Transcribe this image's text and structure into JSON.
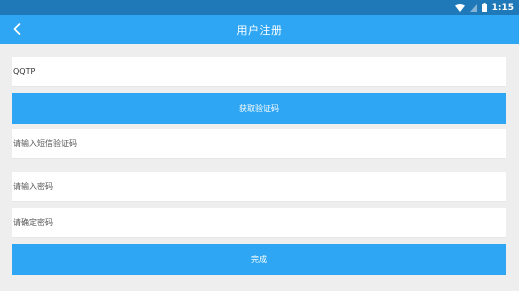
{
  "status_bar": {
    "time": "1:15",
    "icons": [
      "wifi-icon",
      "signal-icon",
      "battery-icon"
    ]
  },
  "header": {
    "title": "用户注册",
    "back_icon": "chevron-left-icon"
  },
  "form": {
    "username": {
      "value": "QQTP",
      "placeholder": ""
    },
    "get_code_label": "获取验证码",
    "sms_code": {
      "value": "",
      "placeholder": "请输入短信验证码"
    },
    "password": {
      "value": "",
      "placeholder": "请输入密码"
    },
    "confirm_password": {
      "value": "",
      "placeholder": "请确定密码"
    },
    "submit_label": "完成"
  },
  "colors": {
    "status_bar": "#1f79b8",
    "accent": "#2ea6f4",
    "background": "#eeeeee"
  }
}
